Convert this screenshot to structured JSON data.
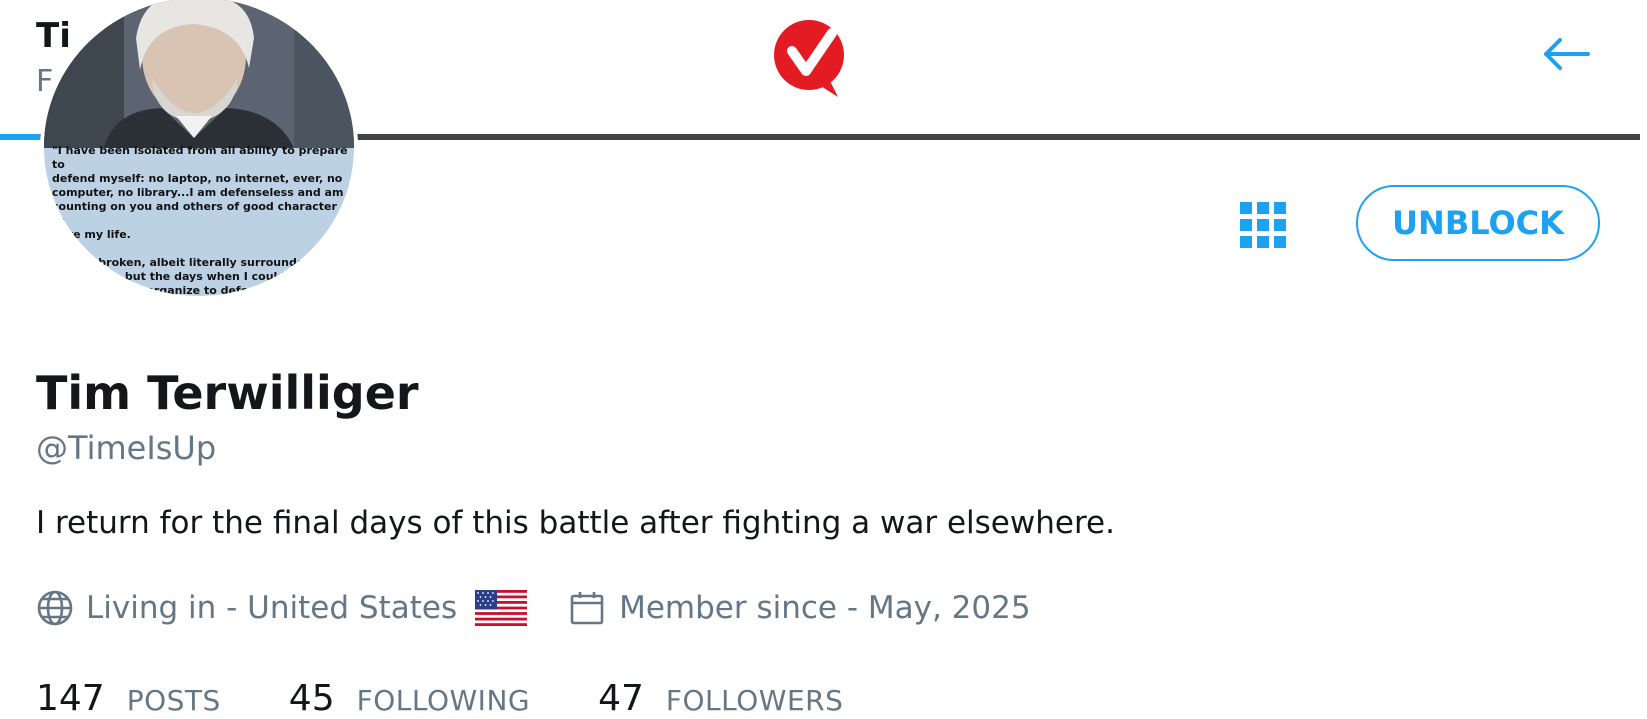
{
  "topbar": {
    "title": "Ti",
    "subtitle": "F",
    "logo": "checkmark-q-logo",
    "back_icon": "arrow-left-icon"
  },
  "profile": {
    "avatar_quote": "\"I have been isolated from all ability to prepare to\ndefend myself: no laptop, no internet, ever, no\ncomputer, no library...I am defenseless and am\ncounting on you and others of good character to\nsave my life.\n\nI am unbroken, albeit literally surrounded by\nmurderers, but the days when I could read\nand speak and organize to defend myself\nand my ideals are over until I am free",
    "name": "Tim Terwilliger",
    "handle": "@TimeIsUp",
    "bio": "I return for the final days of this battle after fighting a war elsewhere.",
    "location": "Living in - United States",
    "member_since": "Member since - May, 2025"
  },
  "actions": {
    "unblock_label": "UNBLOCK",
    "grid_icon": "grid-icon"
  },
  "stats": [
    {
      "value": "147",
      "label": "POSTS"
    },
    {
      "value": "45",
      "label": "FOLLOWING"
    },
    {
      "value": "47",
      "label": "FOLLOWERS"
    }
  ],
  "colors": {
    "accent": "#1da1f2",
    "muted": "#657786",
    "text": "#14171a",
    "logo_red": "#e41b23"
  }
}
